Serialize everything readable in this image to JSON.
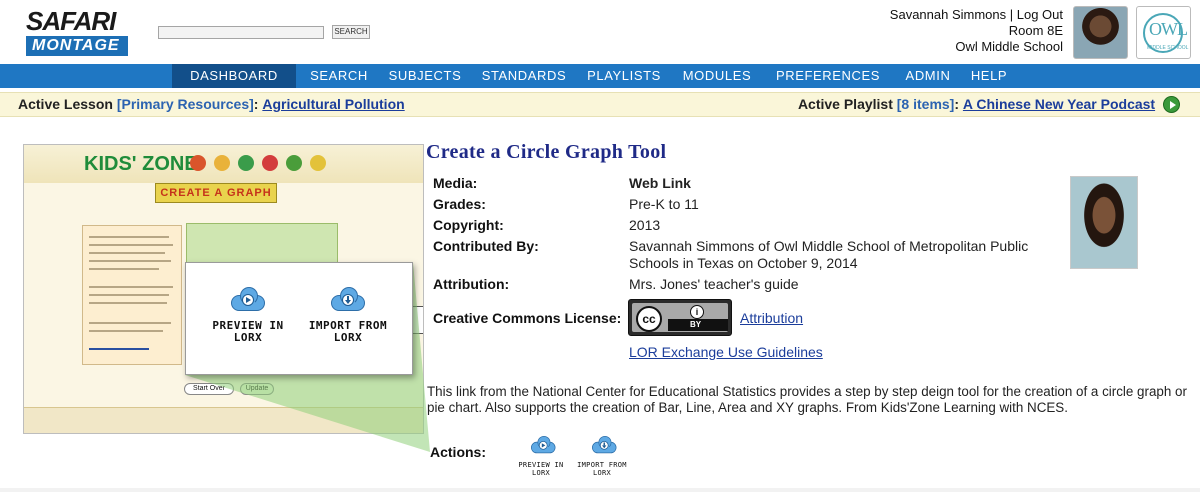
{
  "brand": {
    "top": "SAFARI",
    "bottom": "MONTAGE"
  },
  "search": {
    "placeholder": "",
    "button_label": "SEARCH"
  },
  "user": {
    "name_line": "Savannah Simmons | Log Out",
    "room": "Room 8E",
    "school": "Owl Middle School",
    "school_logo_text": "OWL",
    "school_logo_sub": "MIDDLE SCHOOL"
  },
  "nav": {
    "items": [
      "DASHBOARD",
      "SEARCH",
      "SUBJECTS",
      "STANDARDS",
      "PLAYLISTS",
      "MODULES",
      "PREFERENCES",
      "ADMIN",
      "HELP"
    ],
    "active": "DASHBOARD"
  },
  "active_bar": {
    "lesson_label": "Active Lesson",
    "lesson_bracket": "[Primary Resources]",
    "lesson_colon": ":",
    "lesson_title": "Agricultural Pollution",
    "playlist_label": "Active Playlist",
    "playlist_bracket": "[8 items]",
    "playlist_colon": ":",
    "playlist_title": "A Chinese New Year Podcast"
  },
  "thumbnail": {
    "site_name": "KIDS' ZONE",
    "banner": "CREATE A GRAPH",
    "button_start": "Start Over",
    "button_update": "Update"
  },
  "lorx_popup": {
    "preview_label": "PREVIEW IN LORX",
    "import_label": "IMPORT FROM LORX"
  },
  "resource": {
    "title": "Create a Circle Graph Tool",
    "fields": {
      "media_label": "Media:",
      "media_value": "Web Link",
      "grades_label": "Grades:",
      "grades_value": "Pre-K to 11",
      "copyright_label": "Copyright:",
      "copyright_value": "2013",
      "contributed_label": "Contributed By:",
      "contributed_value_1": "Savannah Simmons of Owl Middle School of Metropolitan Public",
      "contributed_value_2": "Schools in Texas on October 9, 2014",
      "attribution_label": "Attribution:",
      "attribution_value": "Mrs. Jones' teacher's guide",
      "cc_label": "Creative Commons License:",
      "cc_link": "Attribution",
      "cc_badge_cc": "cc",
      "cc_badge_by": "BY",
      "lor_link": "LOR Exchange Use Guidelines"
    },
    "description": "This link from the National Center for Educational Statistics provides a step by step deign tool for the creation of a circle graph or pie chart. Also supports the creation of Bar, Line, Area and XY graphs. From Kids'Zone Learning with NCES.",
    "actions_label": "Actions:",
    "action_preview": "PREVIEW IN LORX",
    "action_import": "IMPORT FROM LORX"
  },
  "colors": {
    "nav_bg": "#1f77c3",
    "nav_active": "#124f8a",
    "title": "#1f2a87",
    "link": "#1b3d9b",
    "active_bar_bg": "#faf6d9",
    "wedge": "#8fcf7a"
  }
}
